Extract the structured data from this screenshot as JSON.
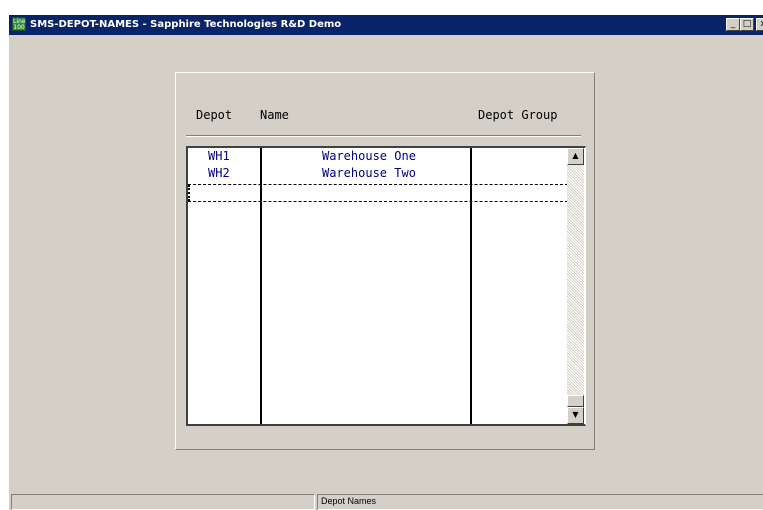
{
  "window": {
    "icon_text": "Line 100",
    "title": "SMS-DEPOT-NAMES - Sapphire Technologies R&D Demo",
    "controls": {
      "minimize": "_",
      "maximize": "□",
      "close": "x"
    }
  },
  "table": {
    "headers": [
      "Depot",
      "Name",
      "Depot Group"
    ],
    "rows": [
      {
        "code": "WH1",
        "name": "Warehouse One",
        "group": ""
      },
      {
        "code": "WH2",
        "name": "Warehouse Two",
        "group": ""
      }
    ]
  },
  "scrollbar": {
    "up_arrow": "▲",
    "down_arrow": "▼"
  },
  "statusbar": {
    "left": "",
    "right": "Depot Names"
  }
}
